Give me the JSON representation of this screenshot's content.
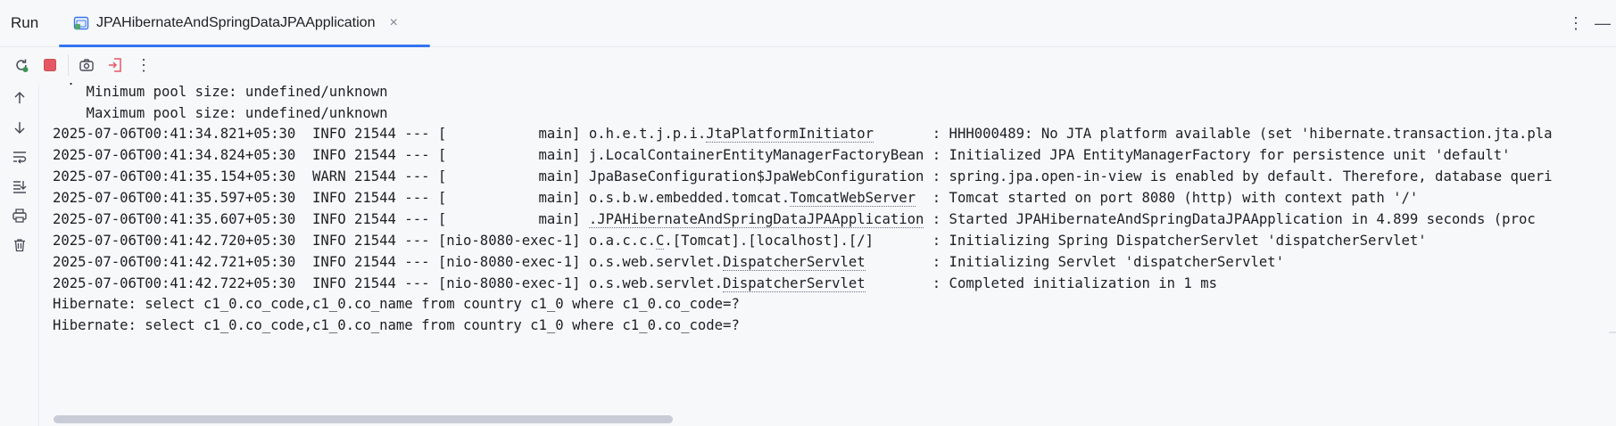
{
  "tool_window": {
    "title": "Run",
    "tab_label": "JPAHibernateAndSpringDataJPAApplication",
    "tab_close": "×",
    "more_symbol": "⋮",
    "minimize_symbol": "—"
  },
  "toolbar": {
    "rerun": "rerun-icon",
    "stop": "stop-icon",
    "screenshot": "camera-icon",
    "exit": "exit-icon",
    "more": "⋮"
  },
  "console": {
    "top_cut": "·",
    "lines": [
      {
        "text": "    Minimum pool size: undefined/unknown"
      },
      {
        "text": "    Maximum pool size: undefined/unknown"
      },
      {
        "prefix": "2025-07-06T00:41:34.821+05:30  INFO 21544 --- [           main] o.h.e.t.j.p.i.",
        "link": "JtaPlatformInitiator",
        "suffix": "       : HHH000489: No JTA platform available (set 'hibernate.transaction.jta.pla"
      },
      {
        "prefix": "2025-07-06T00:41:34.824+05:30  INFO 21544 --- [           main] j.LocalContainerEntityManagerFactoryBean : Initialized JPA EntityManagerFactory for persistence unit 'default'"
      },
      {
        "prefix": "2025-07-06T00:41:35.154+05:30  WARN 21544 --- [           main] JpaBaseConfiguration$JpaWebConfiguration : spring.jpa.open-in-view is enabled by default. Therefore, database queri"
      },
      {
        "prefix": "2025-07-06T00:41:35.597+05:30  INFO 21544 --- [           main] o.s.b.w.embedded.tomcat.",
        "link": "TomcatWebServer",
        "suffix": "  : Tomcat started on port 8080 (http) with context path '/'"
      },
      {
        "prefix": "2025-07-06T00:41:35.607+05:30  INFO 21544 --- [           main] ",
        "link": ".JPAHibernateAndSpringDataJPAApplication",
        "suffix": " : Started JPAHibernateAndSpringDataJPAApplication in 4.899 seconds (proc"
      },
      {
        "prefix": "2025-07-06T00:41:42.720+05:30  INFO 21544 --- [nio-8080-exec-1] o.a.c.c.",
        "link": "C",
        "suffix": ".[Tomcat].[localhost].[/]       : Initializing Spring DispatcherServlet 'dispatcherServlet'"
      },
      {
        "prefix": "2025-07-06T00:41:42.721+05:30  INFO 21544 --- [nio-8080-exec-1] o.s.web.servlet.",
        "link": "DispatcherServlet",
        "suffix": "        : Initializing Servlet 'dispatcherServlet'"
      },
      {
        "prefix": "2025-07-06T00:41:42.722+05:30  INFO 21544 --- [nio-8080-exec-1] o.s.web.servlet.",
        "link": "DispatcherServlet",
        "suffix": "        : Completed initialization in 1 ms"
      },
      {
        "text": "Hibernate: select c1_0.co_code,c1_0.co_name from country c1_0 where c1_0.co_code=?"
      },
      {
        "text": "Hibernate: select c1_0.co_code,c1_0.co_name from country c1_0 where c1_0.co_code=?"
      }
    ]
  },
  "colors": {
    "accent": "#3574f0",
    "stop": "#e55765",
    "rerun": "#369650"
  }
}
